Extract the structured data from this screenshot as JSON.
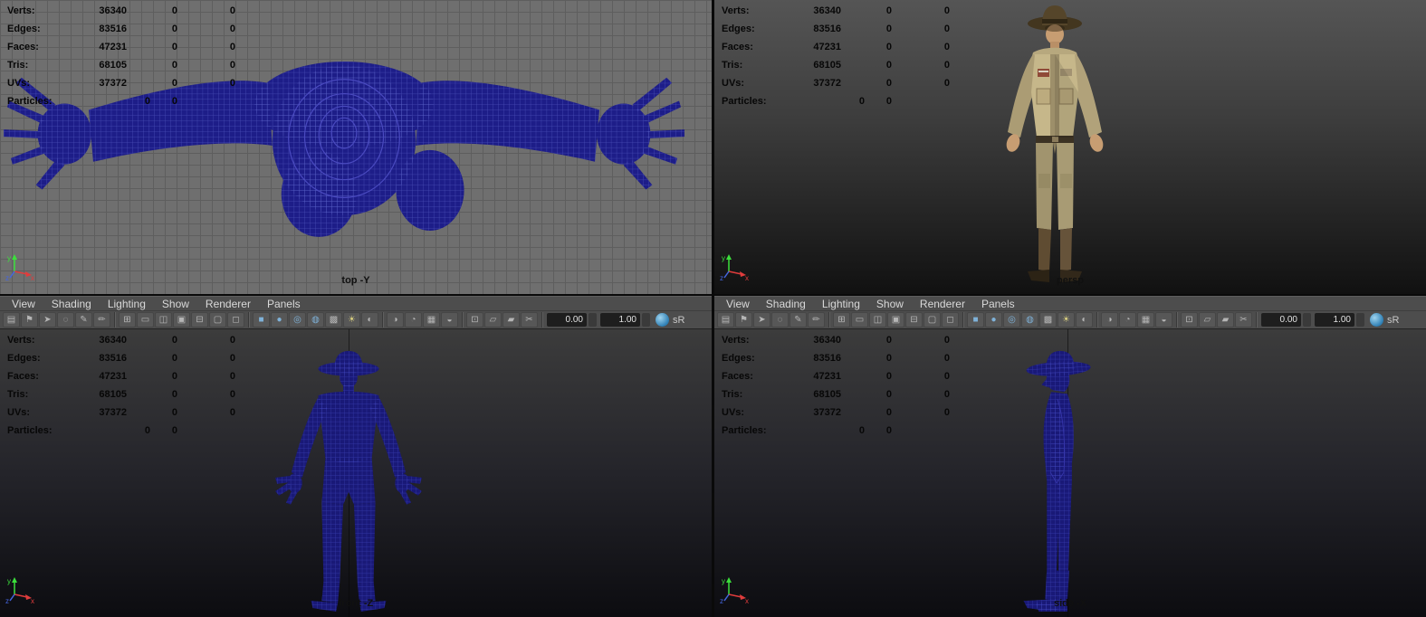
{
  "hud": {
    "rows": [
      {
        "label": "Verts:",
        "values": [
          "36340",
          "0",
          "0"
        ]
      },
      {
        "label": "Edges:",
        "values": [
          "83516",
          "0",
          "0"
        ]
      },
      {
        "label": "Faces:",
        "values": [
          "47231",
          "0",
          "0"
        ]
      },
      {
        "label": "Tris:",
        "values": [
          "68105",
          "0",
          "0"
        ]
      },
      {
        "label": "UVs:",
        "values": [
          "37372",
          "0",
          "0"
        ]
      },
      {
        "label": "Particles:",
        "values": [
          "0",
          "0"
        ]
      }
    ]
  },
  "panel_menus": [
    "View",
    "Shading",
    "Lighting",
    "Show",
    "Renderer",
    "Panels"
  ],
  "toolbar": {
    "icon_groups": [
      [
        {
          "name": "panel-menu-icon",
          "glyph": "▤"
        },
        {
          "name": "bookmark-icon",
          "glyph": "⚑"
        },
        {
          "name": "select-tool-icon",
          "glyph": "➤"
        },
        {
          "name": "lasso-select-icon",
          "glyph": "◌"
        },
        {
          "name": "paint-select-icon",
          "glyph": "✎"
        },
        {
          "name": "pencil-tool-icon",
          "glyph": "✏"
        }
      ],
      [
        {
          "name": "grid-toggle-icon",
          "glyph": "⊞"
        },
        {
          "name": "film-gate-icon",
          "glyph": "▭"
        },
        {
          "name": "resolution-gate-icon",
          "glyph": "◫"
        },
        {
          "name": "gate-mask-icon",
          "glyph": "▣"
        },
        {
          "name": "field-chart-icon",
          "glyph": "⊟"
        },
        {
          "name": "safe-action-icon",
          "glyph": "▢"
        },
        {
          "name": "safe-title-icon",
          "glyph": "◻"
        }
      ],
      [
        {
          "name": "shaded-display-icon",
          "glyph": "■",
          "color": "#7fb2d9"
        },
        {
          "name": "smooth-shade-icon",
          "glyph": "●",
          "color": "#7fb2d9"
        },
        {
          "name": "flat-shade-icon",
          "glyph": "◎",
          "color": "#7fb2d9"
        },
        {
          "name": "wireframe-on-shaded-icon",
          "glyph": "◍",
          "color": "#7fb2d9"
        },
        {
          "name": "textured-display-icon",
          "glyph": "▩"
        },
        {
          "name": "use-all-lights-icon",
          "glyph": "☀",
          "color": "#d9cf7f"
        },
        {
          "name": "shadows-icon",
          "glyph": "◐"
        }
      ],
      [
        {
          "name": "screen-ao-icon",
          "glyph": "◑"
        },
        {
          "name": "motion-blur-icon",
          "glyph": "◔"
        },
        {
          "name": "multisample-aa-icon",
          "glyph": "▦"
        },
        {
          "name": "depth-of-field-icon",
          "glyph": "◒"
        }
      ],
      [
        {
          "name": "isolate-select-icon",
          "glyph": "⊡"
        },
        {
          "name": "xray-icon",
          "glyph": "▱"
        },
        {
          "name": "xray-joints-icon",
          "glyph": "▰"
        },
        {
          "name": "clip-plane-icon",
          "glyph": "✂"
        }
      ]
    ],
    "exposure_value": "0.00",
    "gamma_value": "1.00",
    "srgb_label": "sR"
  },
  "viewports": {
    "top": {
      "label": "top -Y"
    },
    "persp": {
      "label": "persp"
    },
    "front": {
      "label": "front -Z"
    },
    "side": {
      "label": "side -X"
    }
  },
  "axis_labels": {
    "x": "x",
    "y": "y",
    "z": "z"
  },
  "colors": {
    "wireframe_blue": "#1d1d88",
    "panel_chrome": "#4d4d4d",
    "grid_background": "#6f6f6f",
    "axis_x_red": "#e03c3c",
    "axis_y_green": "#3ce03c",
    "axis_z_blue": "#4466e0"
  }
}
